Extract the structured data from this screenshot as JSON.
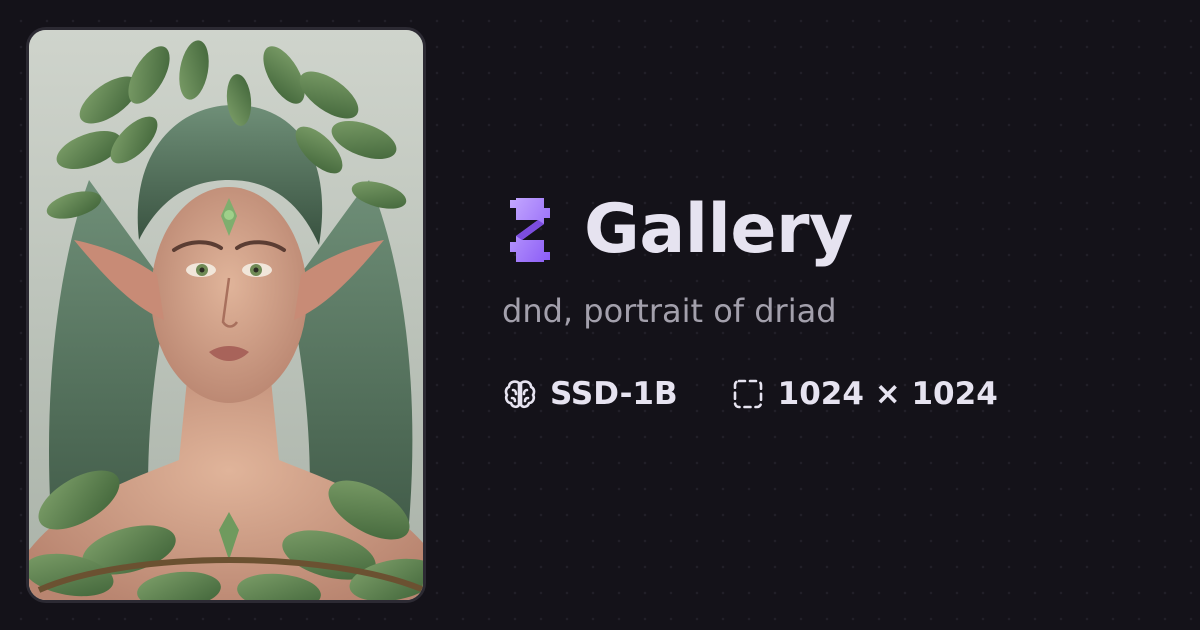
{
  "header": {
    "title": "Gallery",
    "logo_icon": "puzzle-bolt-logo-icon",
    "accent": "#a78bfa"
  },
  "image": {
    "alt": "dnd, portrait of driad",
    "prompt": "dnd, portrait of driad"
  },
  "meta": {
    "model_icon": "brain-icon",
    "model": "SSD-1B",
    "dimensions_icon": "dashed-frame-icon",
    "dimensions": "1024 × 1024"
  }
}
